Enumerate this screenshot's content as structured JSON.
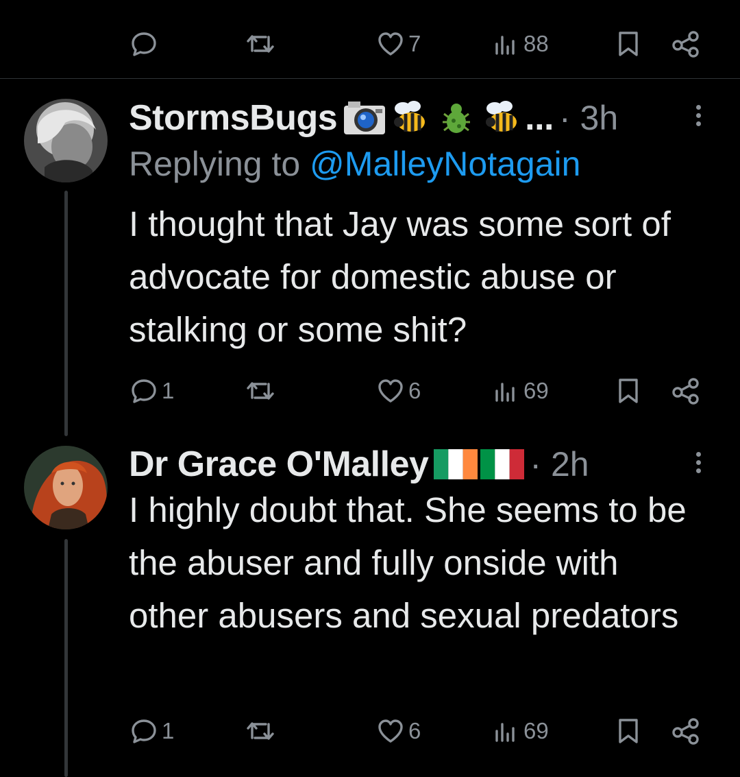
{
  "top_actions": {
    "replies": "",
    "reposts": "",
    "likes": "7",
    "views": "88"
  },
  "tweets": [
    {
      "display_name": "StormsBugs",
      "emoji_suffix": "...",
      "time": "3h",
      "replying_to_prefix": "Replying to ",
      "replying_to_handle": "@MalleyNotagain",
      "text": "I thought that Jay was some sort of advocate for domestic abuse or stalking or some shit?",
      "actions": {
        "replies": "1",
        "reposts": "",
        "likes": "6",
        "views": "69"
      }
    },
    {
      "display_name": "Dr Grace O'Malley",
      "time": "2h",
      "text": "I highly doubt that. She seems to be the abuser and fully onside with other abusers and sexual predators",
      "actions": {
        "replies": "1",
        "reposts": "",
        "likes": "6",
        "views": "69"
      }
    }
  ],
  "colors": {
    "background": "#000000",
    "text": "#e7e9ea",
    "muted": "#8b9198",
    "link": "#1d9bf0",
    "divider": "#2f3336"
  },
  "icons": [
    "reply-icon",
    "repost-icon",
    "like-icon",
    "views-icon",
    "bookmark-icon",
    "share-icon",
    "more-icon",
    "camera-emoji",
    "bee-emoji",
    "bug-emoji",
    "ireland-flag",
    "italy-flag"
  ]
}
